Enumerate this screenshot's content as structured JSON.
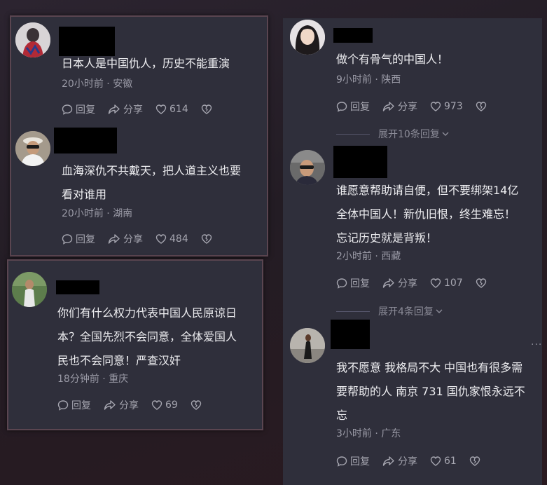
{
  "left_top_panel": {
    "comments": [
      {
        "text_lines": [
          "日本人是中国仇人，历史不能重演"
        ],
        "time": "20小时前",
        "location": "安徽",
        "reply": "回复",
        "share": "分享",
        "likes": "614"
      },
      {
        "text_lines": [
          "血海深仇不共戴天，把人道主义也要",
          "看对谁用"
        ],
        "time": "20小时前",
        "location": "湖南",
        "reply": "回复",
        "share": "分享",
        "likes": "484"
      }
    ]
  },
  "left_bottom_panel": {
    "comment": {
      "text_lines": [
        "你们有什么权力代表中国人民原谅日",
        "本？全国先烈不会同意，全体爱国人",
        "民也不会同意！严查汉奸"
      ],
      "time": "18分钟前",
      "location": "重庆",
      "reply": "回复",
      "share": "分享",
      "likes": "69"
    }
  },
  "right_panel": {
    "comments": [
      {
        "text_lines": [
          "做个有骨气的中国人！"
        ],
        "time": "9小时前",
        "location": "陕西",
        "reply": "回复",
        "share": "分享",
        "likes": "973",
        "expand": "展开10条回复"
      },
      {
        "text_lines": [
          "谁愿意帮助请自便，但不要绑架14亿",
          "全体中国人！新仇旧恨，终生难忘！",
          "忘记历史就是背叛！"
        ],
        "time": "2小时前",
        "location": "西藏",
        "reply": "回复",
        "share": "分享",
        "likes": "107",
        "expand": "展开4条回复"
      },
      {
        "text_lines": [
          "我不愿意 我格局不大 中国也有很多需",
          "要帮助的人 南京 731 国仇家恨永远不",
          "忘"
        ],
        "time": "3小时前",
        "location": "广东",
        "reply": "回复",
        "share": "分享",
        "likes": "61",
        "more": "···"
      }
    ]
  },
  "meta_separator": " · ",
  "icons": {
    "reply": "reply-bubble-icon",
    "share": "share-arrow-icon",
    "like": "heart-icon",
    "dislike": "broken-heart-icon"
  }
}
